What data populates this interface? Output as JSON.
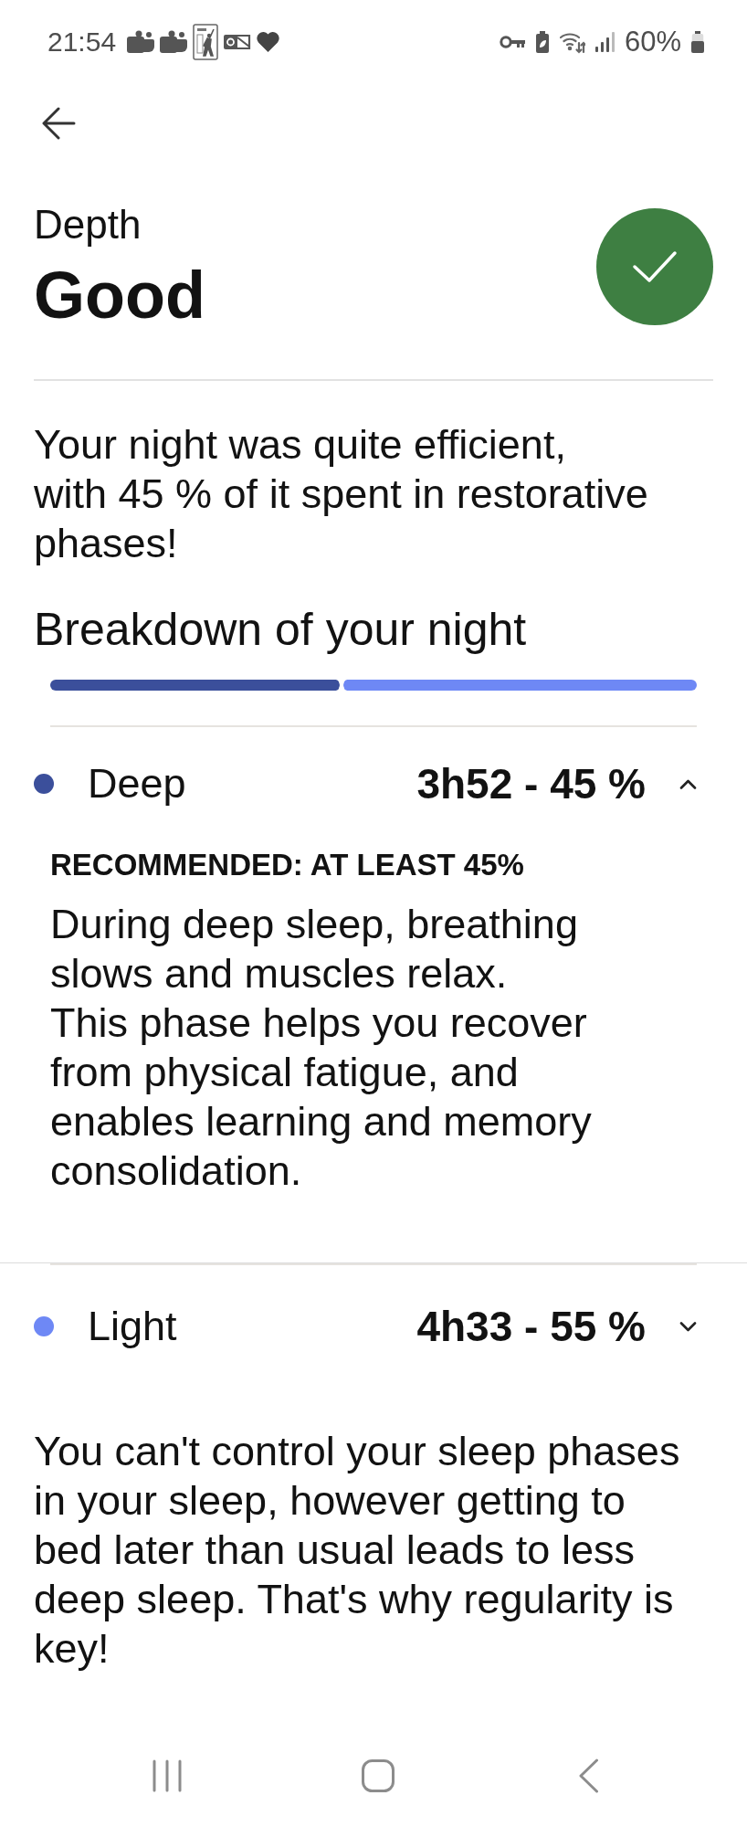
{
  "status_bar": {
    "time": "21:54",
    "battery": "60%"
  },
  "score": {
    "label": "Depth",
    "value": "Good"
  },
  "summary": "Your night was quite efficient, with 45 % of it spent in restorative phases!",
  "breakdown": {
    "title": "Breakdown of your night",
    "phases": [
      {
        "name": "Deep",
        "color": "#3b4f9b",
        "level": 0.45,
        "value": "3h52 - 45 %",
        "expanded": true,
        "recommendation": "RECOMMENDED: AT LEAST 45%",
        "description": [
          "During deep sleep, breathing slows and muscles relax.",
          "This phase helps you recover from physical fatigue, and enables learning and memory consolidation."
        ]
      },
      {
        "name": "Light",
        "color": "#6e88f5",
        "level": 0.55,
        "value": "4h33 - 55 %",
        "expanded": false
      }
    ]
  },
  "note": "You can't control your sleep phases in your sleep, however getting to bed later than usual leads to less deep sleep. That's why regularity is key!"
}
